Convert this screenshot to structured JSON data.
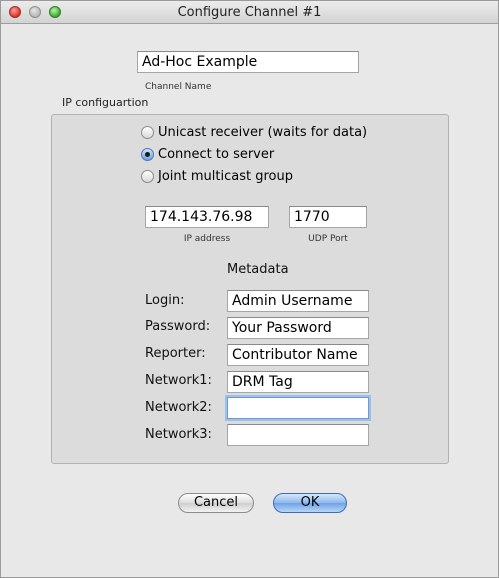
{
  "window": {
    "title": "Configure Channel #1"
  },
  "channel": {
    "name_value": "Ad-Hoc Example",
    "name_label": "Channel Name"
  },
  "ip_group": {
    "title": "IP configuartion",
    "options": [
      {
        "label": "Unicast receiver (waits for data)",
        "checked": false
      },
      {
        "label": "Connect to server",
        "checked": true
      },
      {
        "label": "Joint multicast group",
        "checked": false
      }
    ],
    "ip_address": {
      "value": "174.143.76.98",
      "label": "IP address"
    },
    "udp_port": {
      "value": "1770",
      "label": "UDP Port"
    },
    "metadata_heading": "Metadata",
    "fields": [
      {
        "label": "Login:",
        "value": "Admin Username"
      },
      {
        "label": "Password:",
        "value": "Your Password"
      },
      {
        "label": "Reporter:",
        "value": "Contributor Name"
      },
      {
        "label": "Network1:",
        "value": "DRM Tag"
      },
      {
        "label": "Network2:",
        "value": ""
      },
      {
        "label": "Network3:",
        "value": ""
      }
    ]
  },
  "buttons": {
    "cancel": "Cancel",
    "ok": "OK"
  }
}
